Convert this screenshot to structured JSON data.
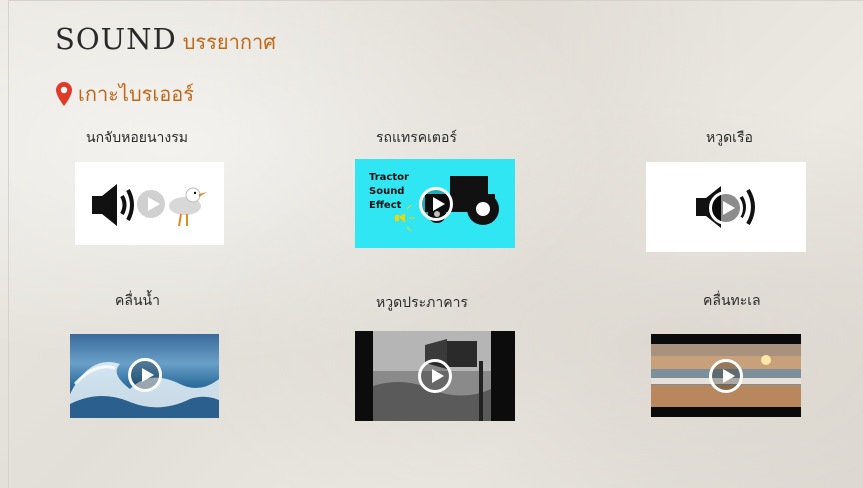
{
  "header": {
    "title": "SOUND",
    "subtitle": "บรรยากาศ",
    "location_icon": "map-pin-icon",
    "location": "เกาะไบรเออร์"
  },
  "colors": {
    "accent": "#c06818",
    "pin": "#e03a2a",
    "play_ring": "#ffffff"
  },
  "sounds": [
    {
      "label": "นกจับหอยนางรม"
    },
    {
      "label": "รถแทรคเตอร์",
      "thumb_text": "Tractor Sound Effect"
    },
    {
      "label": "หวูดเรือ"
    },
    {
      "label": "คลื่นน้ำ"
    },
    {
      "label": "หวูดประภาคาร"
    },
    {
      "label": "คลื่นทะเล"
    }
  ]
}
